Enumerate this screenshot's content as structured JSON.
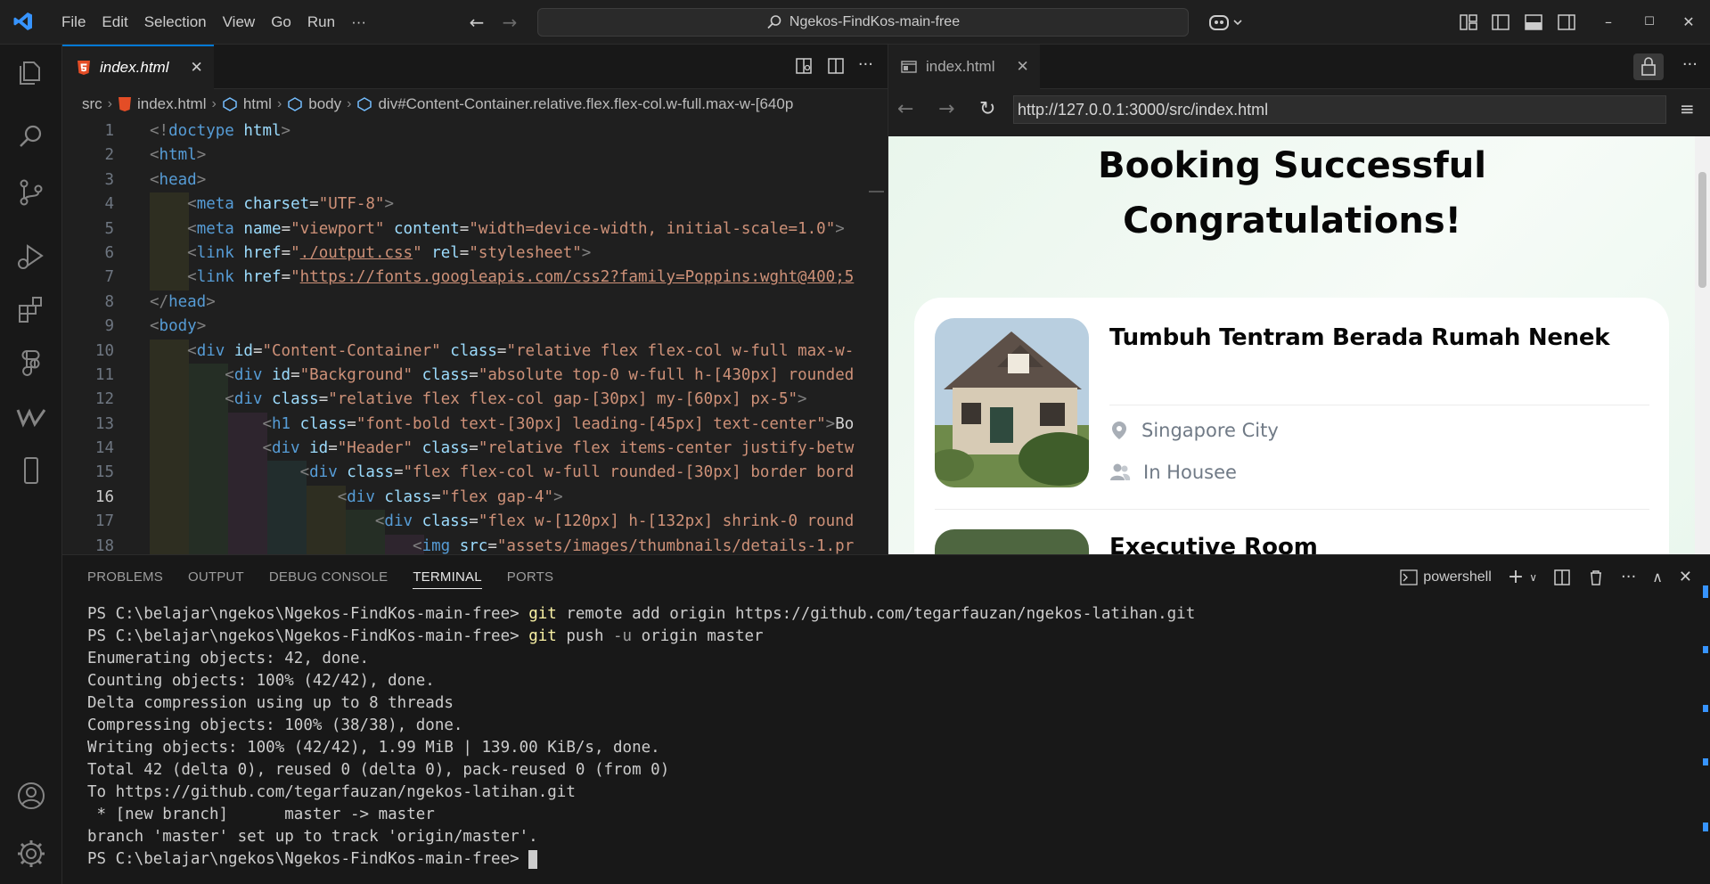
{
  "titlebar": {
    "menu": [
      "File",
      "Edit",
      "Selection",
      "View",
      "Go",
      "Run",
      "···"
    ],
    "search_label": "Ngekos-FindKos-main-free",
    "window_buttons": [
      "–",
      "☐",
      "✕"
    ]
  },
  "editor": {
    "tab_label": "index.html",
    "breadcrumb": [
      "src",
      "index.html",
      "html",
      "body",
      "div#Content-Container.relative.flex.flex-col.w-full.max-w-[640p"
    ],
    "current_line": 16,
    "lines": [
      {
        "n": "1",
        "html": "<span class=\"b\">&lt;!</span><span class=\"t\">doctype</span> <span class=\"a\">html</span><span class=\"b\">&gt;</span>"
      },
      {
        "n": "2",
        "html": "<span class=\"b\">&lt;</span><span class=\"t\">html</span><span class=\"b\">&gt;</span>"
      },
      {
        "n": "3",
        "html": "<span class=\"b\">&lt;</span><span class=\"t\">head</span><span class=\"b\">&gt;</span>"
      },
      {
        "n": "4",
        "html": "    <span class=\"b\">&lt;</span><span class=\"t\">meta</span> <span class=\"a\">charset</span>=<span class=\"s\">\"UTF-8\"</span><span class=\"b\">&gt;</span>"
      },
      {
        "n": "5",
        "html": "    <span class=\"b\">&lt;</span><span class=\"t\">meta</span> <span class=\"a\">name</span>=<span class=\"s\">\"viewport\"</span> <span class=\"a\">content</span>=<span class=\"s\">\"width=device-width, initial-scale=1.0\"</span><span class=\"b\">&gt;</span>"
      },
      {
        "n": "6",
        "html": "    <span class=\"b\">&lt;</span><span class=\"t\">link</span> <span class=\"a\">href</span>=<span class=\"s\">\"</span><span class=\"sl\">./output.css</span><span class=\"s\">\"</span> <span class=\"a\">rel</span>=<span class=\"s\">\"stylesheet\"</span><span class=\"b\">&gt;</span>"
      },
      {
        "n": "7",
        "html": "    <span class=\"b\">&lt;</span><span class=\"t\">link</span> <span class=\"a\">href</span>=<span class=\"s\">\"</span><span class=\"sl\">https://fonts.googleapis.com/css2?family=Poppins:wght@400;5</span>"
      },
      {
        "n": "8",
        "html": "<span class=\"b\">&lt;/</span><span class=\"t\">head</span><span class=\"b\">&gt;</span>"
      },
      {
        "n": "9",
        "html": "<span class=\"b\">&lt;</span><span class=\"t\">body</span><span class=\"b\">&gt;</span>"
      },
      {
        "n": "10",
        "html": "    <span class=\"b\">&lt;</span><span class=\"t\">div</span> <span class=\"a\">id</span>=<span class=\"s\">\"Content-Container\"</span> <span class=\"a\">class</span>=<span class=\"s\">\"relative flex flex-col w-full max-w-</span>"
      },
      {
        "n": "11",
        "html": "        <span class=\"b\">&lt;</span><span class=\"t\">div</span> <span class=\"a\">id</span>=<span class=\"s\">\"Background\"</span> <span class=\"a\">class</span>=<span class=\"s\">\"absolute top-0 w-full h-[430px] rounded</span>"
      },
      {
        "n": "12",
        "html": "        <span class=\"b\">&lt;</span><span class=\"t\">div</span> <span class=\"a\">class</span>=<span class=\"s\">\"relative flex flex-col gap-[30px] my-[60px] px-5\"</span><span class=\"b\">&gt;</span>"
      },
      {
        "n": "13",
        "html": "            <span class=\"b\">&lt;</span><span class=\"t\">h1</span> <span class=\"a\">class</span>=<span class=\"s\">\"font-bold text-[30px] leading-[45px] text-center\"</span><span class=\"b\">&gt;</span><span class=\"w\">Bo</span>"
      },
      {
        "n": "14",
        "html": "            <span class=\"b\">&lt;</span><span class=\"t\">div</span> <span class=\"a\">id</span>=<span class=\"s\">\"Header\"</span> <span class=\"a\">class</span>=<span class=\"s\">\"relative flex items-center justify-betw</span>"
      },
      {
        "n": "15",
        "html": "                <span class=\"b\">&lt;</span><span class=\"t\">div</span> <span class=\"a\">class</span>=<span class=\"s\">\"flex flex-col w-full rounded-[30px] border bord</span>"
      },
      {
        "n": "16",
        "html": "                    <span class=\"b\">&lt;</span><span class=\"t\">div</span> <span class=\"a\">class</span>=<span class=\"s\">\"flex gap-4\"</span><span class=\"b\">&gt;</span>"
      },
      {
        "n": "17",
        "html": "                        <span class=\"b\">&lt;</span><span class=\"t\">div</span> <span class=\"a\">class</span>=<span class=\"s\">\"flex w-[120px] h-[132px] shrink-0 round</span>"
      },
      {
        "n": "18",
        "html": "                            <span class=\"b\">&lt;</span><span class=\"t\">img</span> <span class=\"a\">src</span>=<span class=\"s\">\"assets/images/thumbnails/details-1.pr</span>"
      }
    ]
  },
  "browser": {
    "tab_label": "index.html",
    "url": "http://127.0.0.1:3000/src/index.html",
    "page": {
      "title_line1": "Booking Successful",
      "title_line2": "Congratulations!",
      "room_name": "Tumbuh Tentram Berada Rumah Nenek",
      "location": "Singapore City",
      "category": "In Housee",
      "next_room": "Executive Room"
    }
  },
  "panel": {
    "tabs": [
      "PROBLEMS",
      "OUTPUT",
      "DEBUG CONSOLE",
      "TERMINAL",
      "PORTS"
    ],
    "active_tab": "TERMINAL",
    "shell_label": "powershell",
    "terminal": [
      {
        "prompt": "PS C:\\belajar\\ngekos\\Ngekos-FindKos-main-free> ",
        "cmd": "git",
        "rest": " remote add origin https://github.com/tegarfauzan/ngekos-latihan.git"
      },
      {
        "prompt": "PS C:\\belajar\\ngekos\\Ngekos-FindKos-main-free> ",
        "cmd": "git",
        "rest": " push ",
        "flag": "-u",
        "rest2": " origin master"
      },
      {
        "out": "Enumerating objects: 42, done."
      },
      {
        "out": "Counting objects: 100% (42/42), done."
      },
      {
        "out": "Delta compression using up to 8 threads"
      },
      {
        "out": "Compressing objects: 100% (38/38), done."
      },
      {
        "out": "Writing objects: 100% (42/42), 1.99 MiB | 139.00 KiB/s, done."
      },
      {
        "out": "Total 42 (delta 0), reused 0 (delta 0), pack-reused 0 (from 0)"
      },
      {
        "out": "To https://github.com/tegarfauzan/ngekos-latihan.git"
      },
      {
        "out": " * [new branch]      master -> master"
      },
      {
        "out": "branch 'master' set up to track 'origin/master'."
      },
      {
        "prompt": "PS C:\\belajar\\ngekos\\Ngekos-FindKos-main-free> ",
        "cursor": true
      }
    ]
  }
}
